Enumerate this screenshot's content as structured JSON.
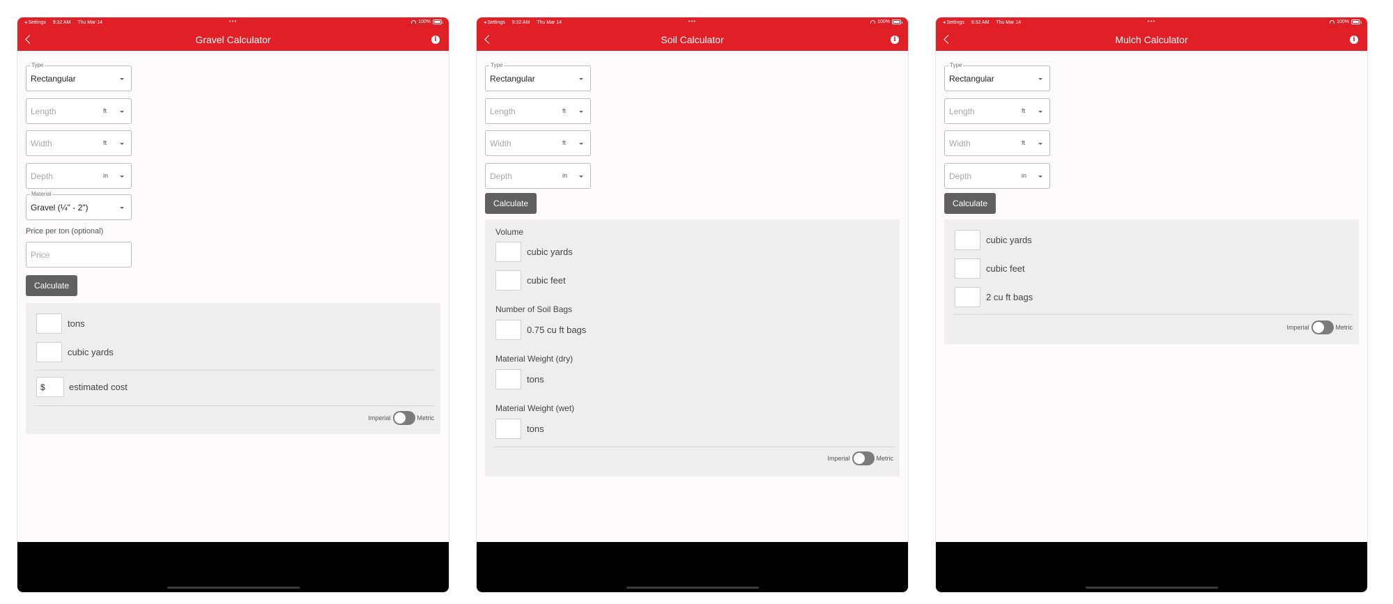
{
  "status_bar": {
    "back_label": "◂ Settings",
    "time": "9:32 AM",
    "date": "Thu Mar 14",
    "dots": "•••",
    "battery": "100%"
  },
  "common": {
    "type_label": "Type",
    "type_value": "Rectangular",
    "length_placeholder": "Length",
    "width_placeholder": "Width",
    "depth_placeholder": "Depth",
    "unit_ft": "ft",
    "unit_in": "in",
    "calculate_label": "Calculate",
    "toggle_left": "Imperial",
    "toggle_right": "Metric"
  },
  "gravel": {
    "title": "Gravel Calculator",
    "material_label": "Material",
    "material_value": "Gravel (¼\" - 2\")",
    "price_label": "Price per ton (optional)",
    "price_placeholder": "Price",
    "result_tons": "tons",
    "result_cubic_yards": "cubic yards",
    "currency": "$",
    "estimated_cost": "estimated cost"
  },
  "soil": {
    "title": "Soil Calculator",
    "volume_label": "Volume",
    "cubic_yards": "cubic yards",
    "cubic_feet": "cubic feet",
    "bags_label": "Number of Soil Bags",
    "bags_unit": "0.75 cu ft bags",
    "weight_dry_label": "Material Weight (dry)",
    "weight_dry_unit": "tons",
    "weight_wet_label": "Material Weight (wet)",
    "weight_wet_unit": "tons"
  },
  "mulch": {
    "title": "Mulch Calculator",
    "cubic_yards": "cubic yards",
    "cubic_feet": "cubic feet",
    "bags_unit": "2 cu ft bags"
  },
  "colors": {
    "accent": "#e01f26",
    "button": "#616161",
    "panel": "#eeeeee"
  }
}
